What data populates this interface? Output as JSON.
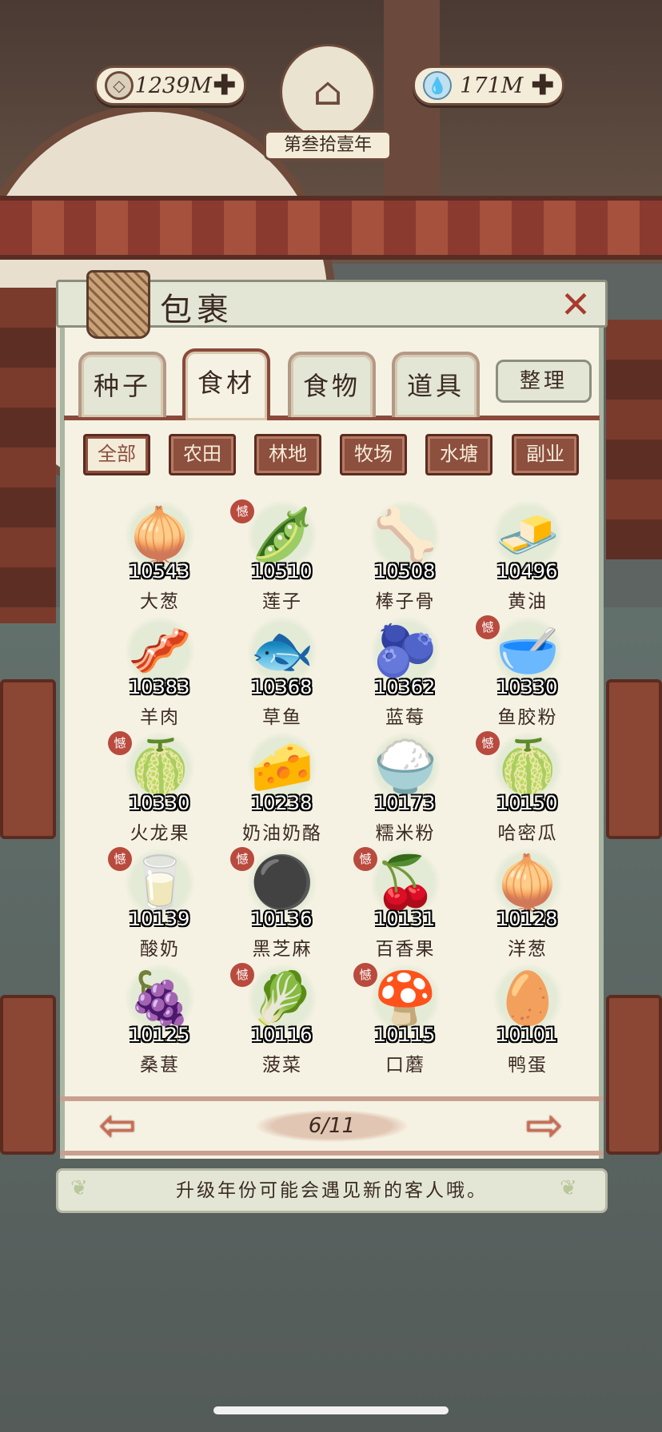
{
  "hud": {
    "coins": "1239M",
    "water": "171M",
    "plus": "✚",
    "year": "第叁拾壹年"
  },
  "panel": {
    "title": "包裹",
    "close": "✕"
  },
  "tabs": [
    "种子",
    "食材",
    "食物",
    "道具"
  ],
  "active_tab": "食材",
  "sort_label": "整理",
  "filters": [
    "全部",
    "农田",
    "林地",
    "牧场",
    "水塘",
    "副业"
  ],
  "active_filter": "全部",
  "new_badge": "憾",
  "items": [
    {
      "name": "大葱",
      "count": "10543",
      "icon": "🧅",
      "new": false
    },
    {
      "name": "莲子",
      "count": "10510",
      "icon": "🫛",
      "new": true
    },
    {
      "name": "棒子骨",
      "count": "10508",
      "icon": "🦴",
      "new": false
    },
    {
      "name": "黄油",
      "count": "10496",
      "icon": "🧈",
      "new": false
    },
    {
      "name": "羊肉",
      "count": "10383",
      "icon": "🥓",
      "new": false
    },
    {
      "name": "草鱼",
      "count": "10368",
      "icon": "🐟",
      "new": false
    },
    {
      "name": "蓝莓",
      "count": "10362",
      "icon": "🫐",
      "new": false
    },
    {
      "name": "鱼胶粉",
      "count": "10330",
      "icon": "🥣",
      "new": true
    },
    {
      "name": "火龙果",
      "count": "10330",
      "icon": "🍈",
      "new": true
    },
    {
      "name": "奶油奶酪",
      "count": "10238",
      "icon": "🧀",
      "new": false
    },
    {
      "name": "糯米粉",
      "count": "10173",
      "icon": "🍚",
      "new": false
    },
    {
      "name": "哈密瓜",
      "count": "10150",
      "icon": "🍈",
      "new": true
    },
    {
      "name": "酸奶",
      "count": "10139",
      "icon": "🥛",
      "new": true
    },
    {
      "name": "黑芝麻",
      "count": "10136",
      "icon": "⚫",
      "new": true
    },
    {
      "name": "百香果",
      "count": "10131",
      "icon": "🍒",
      "new": true
    },
    {
      "name": "洋葱",
      "count": "10128",
      "icon": "🧅",
      "new": false
    },
    {
      "name": "桑葚",
      "count": "10125",
      "icon": "🍇",
      "new": false
    },
    {
      "name": "菠菜",
      "count": "10116",
      "icon": "🥬",
      "new": true
    },
    {
      "name": "口蘑",
      "count": "10115",
      "icon": "🍄",
      "new": true
    },
    {
      "name": "鸭蛋",
      "count": "10101",
      "icon": "🥚",
      "new": false
    }
  ],
  "pager": {
    "page": "6/11",
    "prev": "⇦",
    "next": "⇨"
  },
  "tip": "升级年份可能会遇见新的客人哦。",
  "colors": {
    "accent": "#8d4f3e",
    "panel": "#f6f2e3",
    "close": "#a93a2e"
  }
}
